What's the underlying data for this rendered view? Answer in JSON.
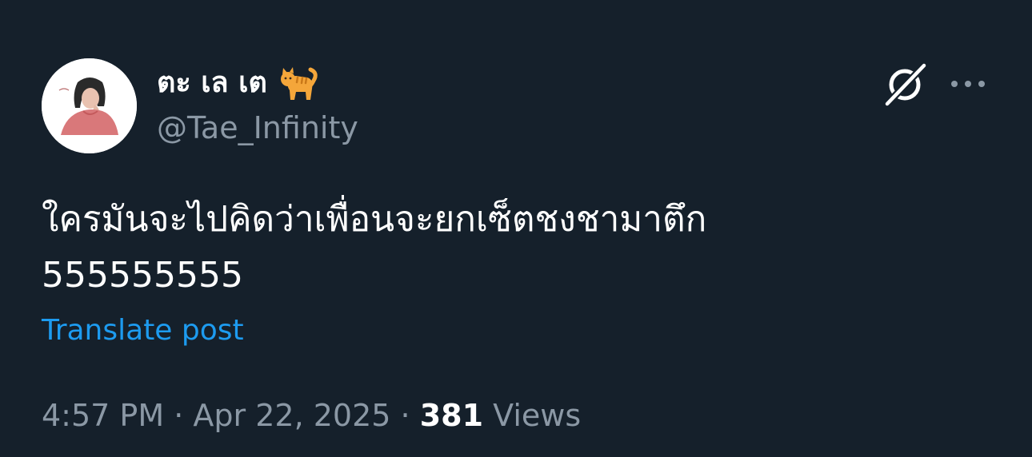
{
  "author": {
    "display_name": "ตะ เล เต",
    "handle": "@Tae_Infinity",
    "name_emoji": "cat-emoji-icon",
    "avatar": "profile-avatar"
  },
  "header_actions": {
    "grok_icon": "grok-icon",
    "more_icon": "more-options-icon"
  },
  "post": {
    "text_line1": "ใครมันจะไปคิดว่าเพื่อนจะยกเซ็ตชงชามาตึก",
    "text_line2": "555555555",
    "translate_label": "Translate post"
  },
  "meta": {
    "time": "4:57 PM",
    "separator": "·",
    "date": "Apr 22, 2025",
    "views_count": "381",
    "views_label": "Views"
  },
  "colors": {
    "background": "#15202b",
    "primary_text": "#ffffff",
    "secondary_text": "#8b98a5",
    "accent": "#1d9bf0"
  }
}
